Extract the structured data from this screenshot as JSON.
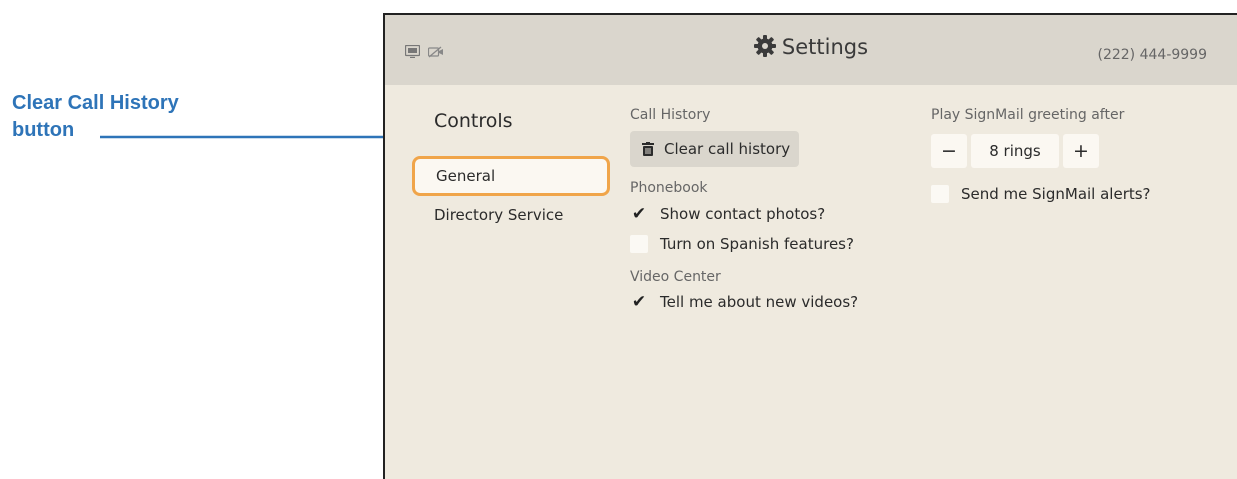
{
  "callout": {
    "line1": "Clear Call History",
    "line2": "button"
  },
  "header": {
    "title": "Settings",
    "phone": "(222) 444-9999",
    "icons": [
      "video-message-icon",
      "camera-off-icon",
      "gear-icon"
    ]
  },
  "sidebar": {
    "title": "Controls",
    "items": [
      {
        "label": "General",
        "selected": true
      },
      {
        "label": "Directory Service",
        "selected": false
      }
    ]
  },
  "call_history": {
    "label": "Call History",
    "button": "Clear call history"
  },
  "phonebook": {
    "label": "Phonebook",
    "options": [
      {
        "label": "Show contact photos?",
        "checked": true
      },
      {
        "label": "Turn on Spanish features?",
        "checked": false
      }
    ]
  },
  "video_center": {
    "label": "Video Center",
    "options": [
      {
        "label": "Tell me about new videos?",
        "checked": true
      }
    ]
  },
  "signmail": {
    "label": "Play SignMail greeting after",
    "rings": "8 rings",
    "decrement": "−",
    "increment": "+",
    "alerts": {
      "label": "Send me SignMail alerts?",
      "checked": false
    }
  },
  "colors": {
    "accent": "#2e74b8",
    "selection": "#f0a54a",
    "screen_bg": "#efeadf",
    "header_bg": "#dad6cd"
  }
}
